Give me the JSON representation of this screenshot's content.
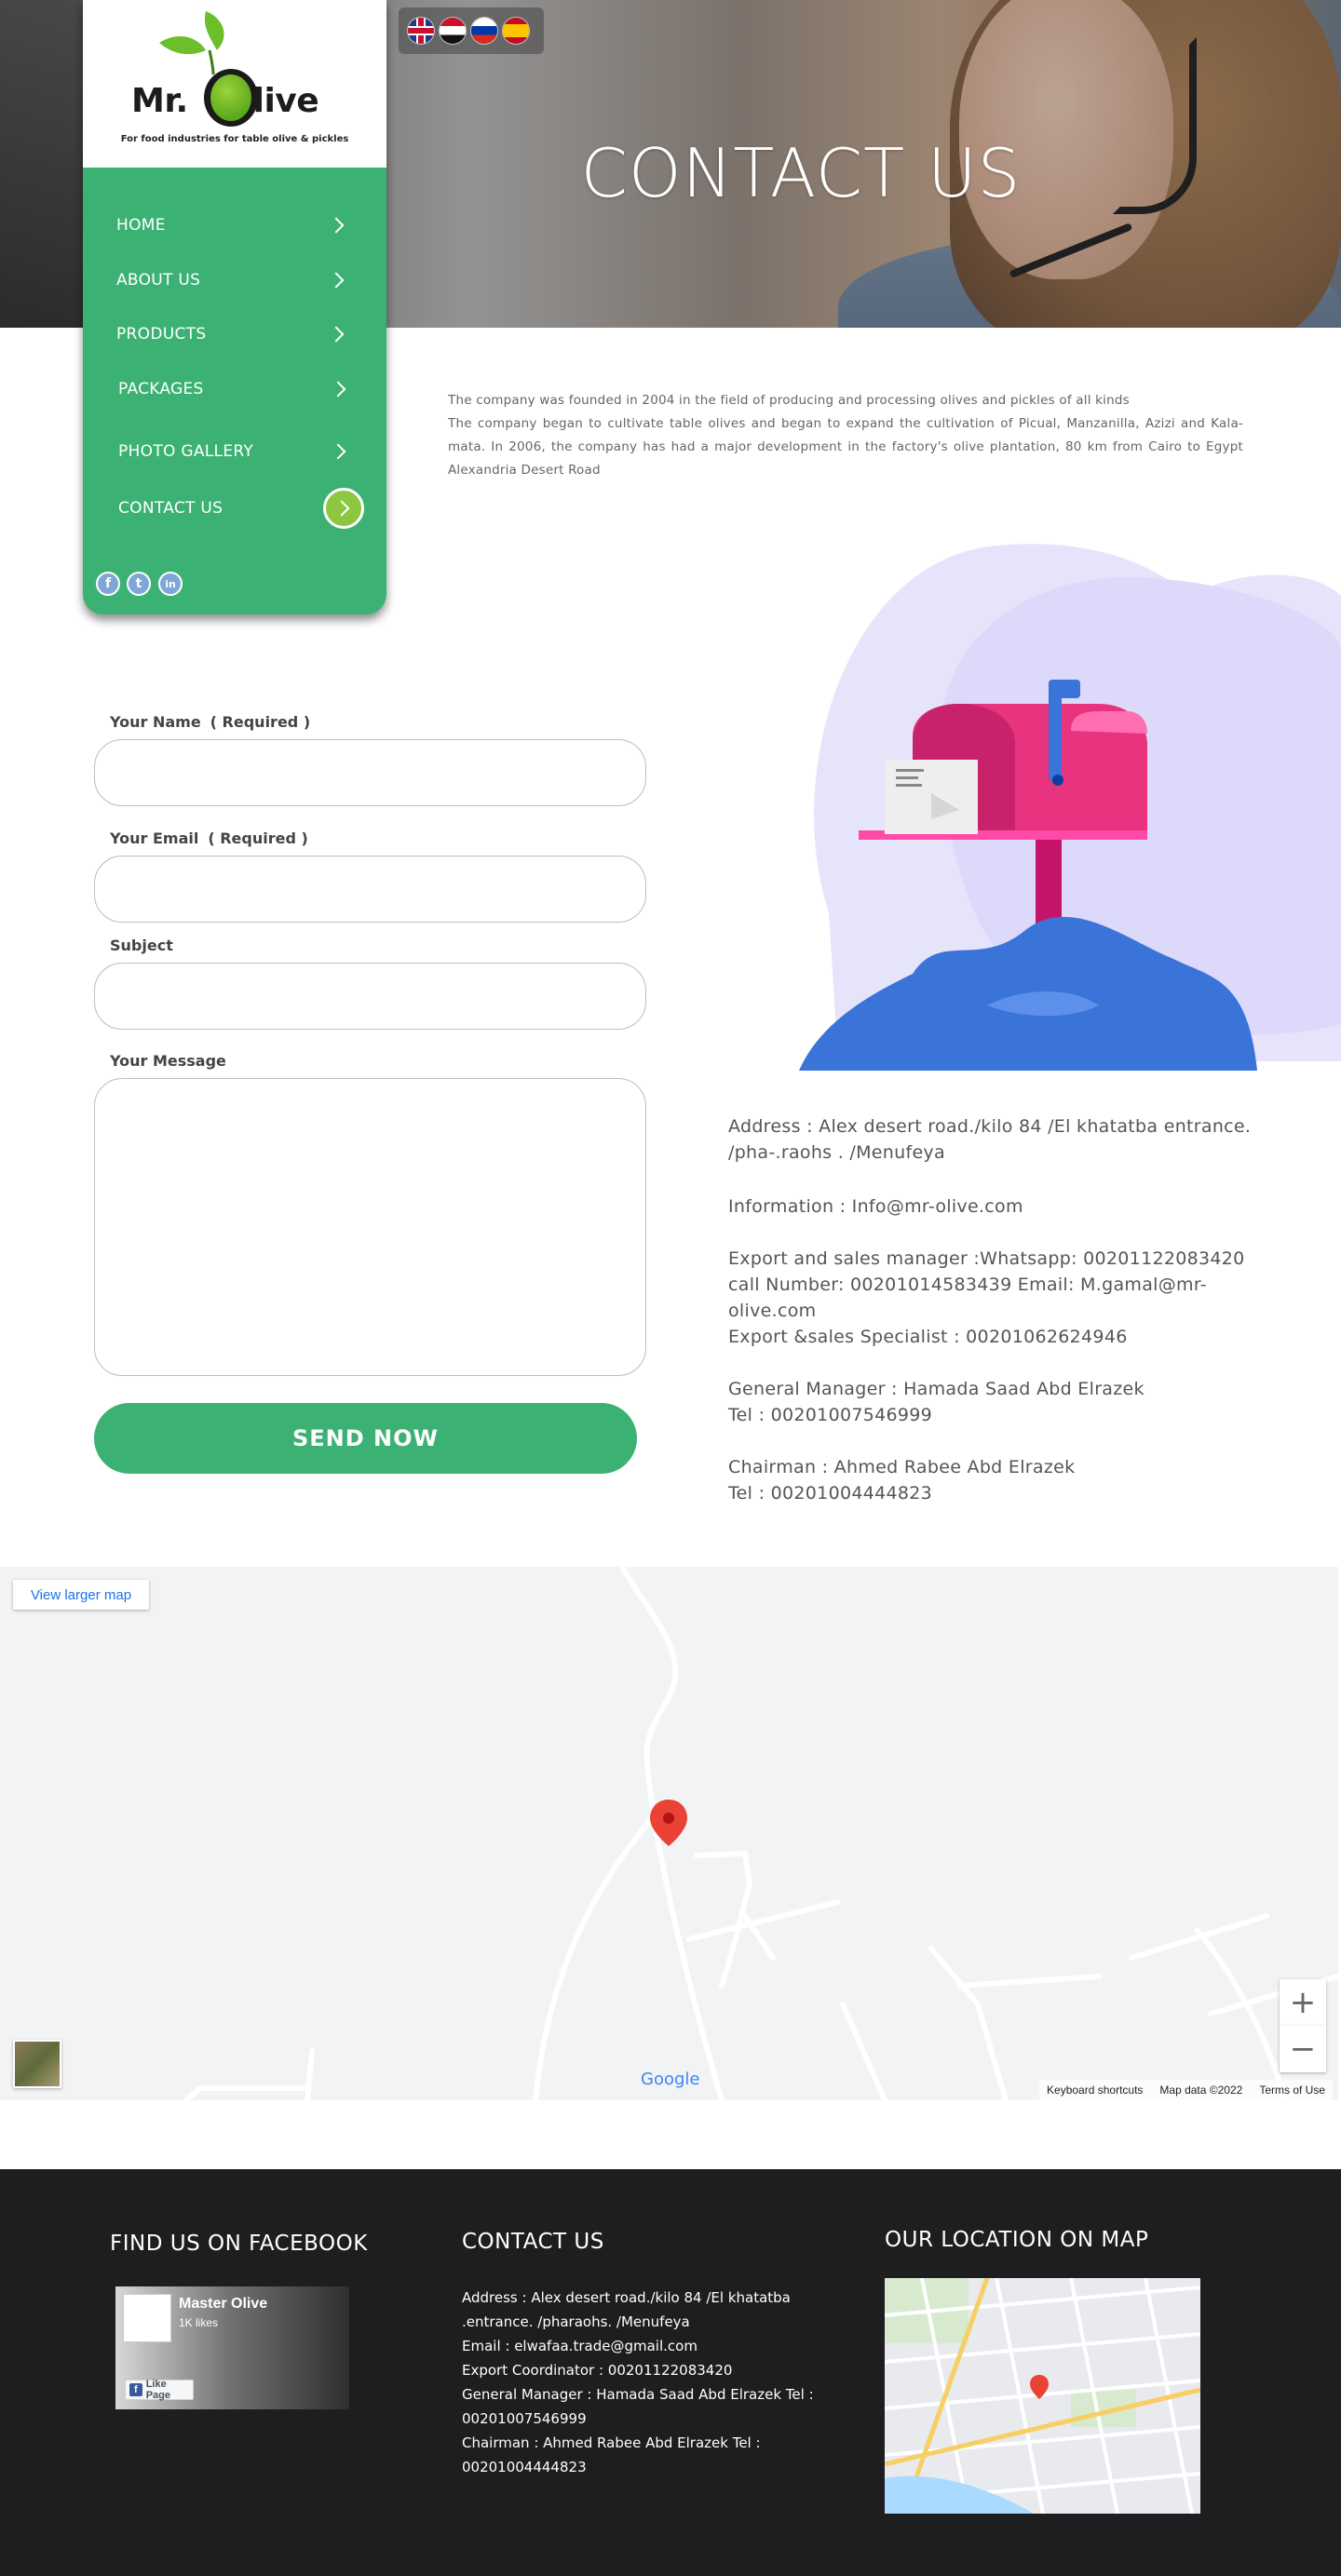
{
  "languages": [
    "English",
    "Arabic",
    "Russian",
    "Spanish"
  ],
  "logo": {
    "brand_left": "Mr.",
    "brand_right": "live",
    "tagline": "For food industries for table olive & pickles"
  },
  "nav": [
    {
      "label": "HOME"
    },
    {
      "label": "ABOUT US"
    },
    {
      "label": "PRODUCTS"
    },
    {
      "label": "PACKAGES"
    },
    {
      "label": "PHOTO GALLERY"
    },
    {
      "label": "CONTACT US"
    }
  ],
  "social": {
    "facebook": "f",
    "twitter": "t",
    "linkedin": "in"
  },
  "hero": {
    "title": "CONTACT US"
  },
  "intro": {
    "line1": "The company was founded in 2004 in the field of producing and processing olives and pickles of all kinds",
    "line2": "The company began to cultivate table olives and began to expand the cultivation of Picual, Manzanilla, Azizi and Kala-mata. In 2006, the company has had a major development in the factory's olive plantation, 80 km from Cairo to Egypt Alexandria Desert Road"
  },
  "form": {
    "name_label": "Your Name",
    "name_required": "( Required )",
    "email_label": "Your Email",
    "email_required": "( Required )",
    "subject_label": "Subject",
    "message_label": "Your Message",
    "send": "SEND NOW"
  },
  "contact_info": {
    "address": "Address : Alex desert road./kilo 84 /El khatatba entrance. /pha-.raohs . /Menufeya",
    "information": "Information : Info@mr-olive.com",
    "export_manager": "Export and sales manager :Whatsapp: 00201122083420",
    "export_call": "call Number: 00201014583439  Email: M.gamal@mr-olive.com",
    "specialist": "Export &sales Specialist : 00201062624946",
    "gm": "General Manager : Hamada Saad Abd Elrazek",
    "gm_tel": "Tel : 00201007546999",
    "chairman": "Chairman :  Ahmed Rabee Abd Elrazek",
    "chairman_tel": "Tel : 00201004444823"
  },
  "map": {
    "larger_link": "View larger map",
    "zoom_in": "+",
    "zoom_out": "−",
    "google": "Google",
    "keyboard": "Keyboard shortcuts",
    "map_data": "Map data ©2022",
    "terms": "Terms of Use"
  },
  "footer": {
    "fb_heading": "FIND US ON FACEBOOK",
    "fb_page_name": "Master Olive",
    "fb_likes": "1K likes",
    "fb_like_btn": "Like Page",
    "contact_heading": "CONTACT US",
    "map_heading": "OUR LOCATION ON MAP",
    "lines": [
      "Address :  Alex desert road./kilo 84 /El khatatba .entrance. /pharaohs. /Menufeya",
      "Email : elwafaa.trade@gmail.com",
      "Export Coordinator : 00201122083420",
      "General Manager : Hamada Saad Abd Elrazek   Tel : 00201007546999",
      "Chairman :  Ahmed Rabee Abd Elrazek  Tel : 00201004444823"
    ]
  },
  "colors": {
    "brand_green": "#3bb273",
    "olive_green": "#8dc63f",
    "footer_bg": "#1e1d1f",
    "map_pin": "#ea4335"
  }
}
